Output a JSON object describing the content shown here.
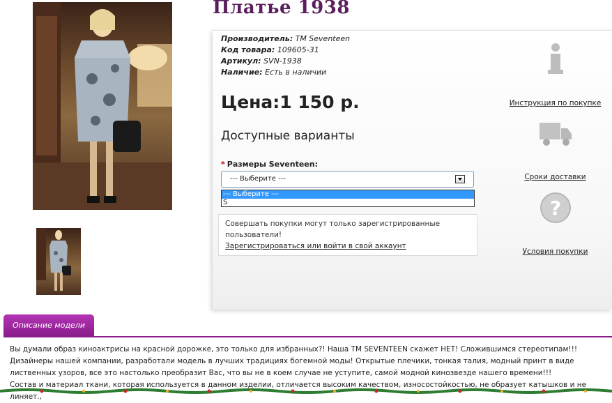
{
  "product": {
    "title": "Платье 1938",
    "meta": [
      {
        "label": "Производитель:",
        "value": "TM Seventeen"
      },
      {
        "label": "Код товара:",
        "value": "109605-31"
      },
      {
        "label": "Артикул:",
        "value": "SVN-1938"
      },
      {
        "label": "Наличие:",
        "value": "Есть в наличии"
      }
    ],
    "price": "Цена:1 150 р."
  },
  "variants": {
    "heading": "Доступные варианты",
    "size_label": "Размеры Seventeen:",
    "required_mark": "*",
    "selected": "--- Выберите ---",
    "options": [
      "--- Выберите ---",
      "S"
    ]
  },
  "notice": {
    "text": "Совершать покупки могут только зарегистрированные пользователи!",
    "link": "Зарегистрироваться или войти в свой аккаунт"
  },
  "info": [
    {
      "icon": "info-icon",
      "label": "Инструкция по покупке"
    },
    {
      "icon": "truck-icon",
      "label": "Сроки доставки"
    },
    {
      "icon": "question-icon",
      "label": "Условия покупки"
    }
  ],
  "description": {
    "tab": "Описание модели",
    "paragraphs": [
      "Вы думали образ киноактрисы на красной дорожке, это только для избранных?! Наша ТМ SEVENTEEN скажет НЕТ! Сложившимся стереотипам!!!",
      "Дизайнеры нашей компании, разработали модель в лучших традициях богемной моды! Открытые плечики, тонкая талия, модный принт в виде лиственных узоров, все это настолько преобразит Вас, что вы не в коем случае не уступите, самой модной кинозвезде нашего времени!!!",
      "Состав и материал ткани, которая используется в данном изделии, отличается высоким качеством, износостойкостью, не образует катышков и не линяет.,"
    ]
  },
  "colors": {
    "brand": "#5a1f5c",
    "tab": "#8a1d8c",
    "select_highlight": "#3399ff"
  }
}
